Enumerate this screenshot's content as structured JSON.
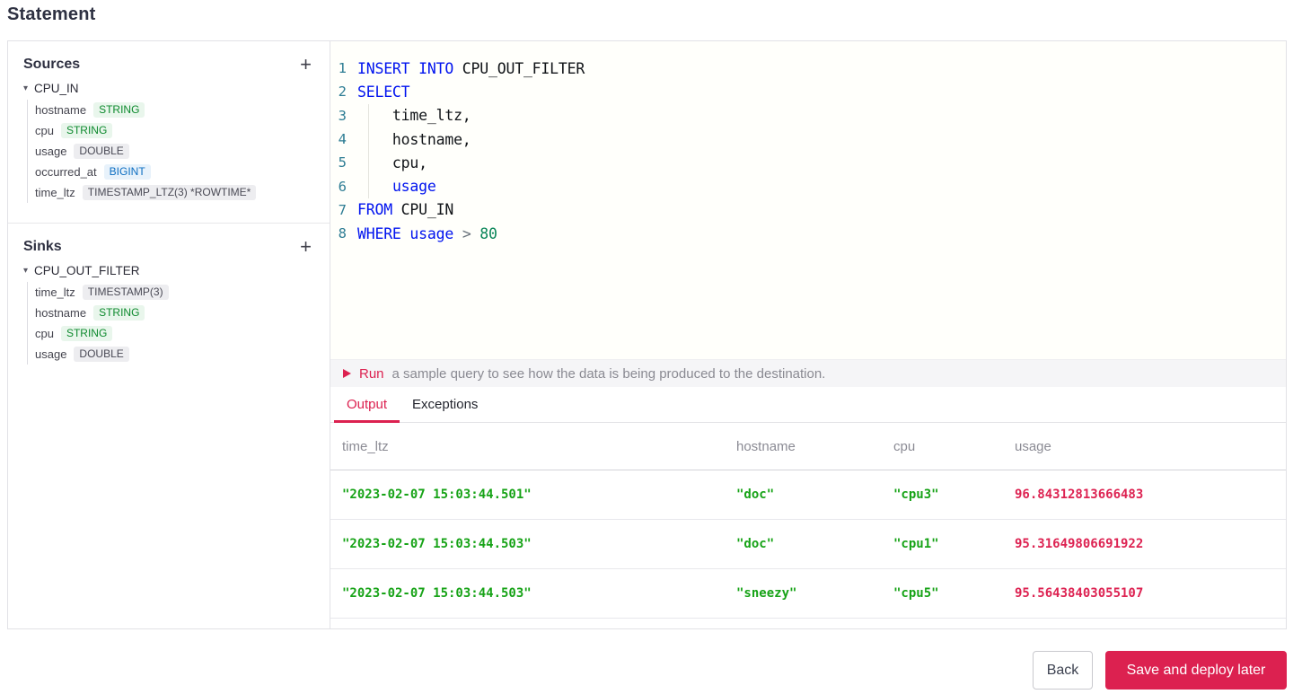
{
  "page": {
    "title": "Statement"
  },
  "colors": {
    "accent_crimson": "#DC2150",
    "keyword_blue": "#0013EF",
    "number_green": "#098658",
    "line_number_teal": "#2E7D94",
    "table_value_green": "#17A317",
    "table_value_red": "#DD2352",
    "badge_green_text": "#0E8A2E",
    "badge_blue_text": "#0D6EC1",
    "badge_gray_text": "#4A4A55"
  },
  "icons": {
    "caret_down": "▾",
    "plus": "+",
    "play": "triangle-right"
  },
  "sources_panel": {
    "title": "Sources",
    "table": {
      "name": "CPU_IN",
      "fields": [
        {
          "name": "hostname",
          "type": "STRING",
          "style": "green"
        },
        {
          "name": "cpu",
          "type": "STRING",
          "style": "green"
        },
        {
          "name": "usage",
          "type": "DOUBLE",
          "style": "gray"
        },
        {
          "name": "occurred_at",
          "type": "BIGINT",
          "style": "blue"
        },
        {
          "name": "time_ltz",
          "type": "TIMESTAMP_LTZ(3) *ROWTIME*",
          "style": "gray"
        }
      ]
    }
  },
  "sinks_panel": {
    "title": "Sinks",
    "table": {
      "name": "CPU_OUT_FILTER",
      "fields": [
        {
          "name": "time_ltz",
          "type": "TIMESTAMP(3)",
          "style": "gray"
        },
        {
          "name": "hostname",
          "type": "STRING",
          "style": "green"
        },
        {
          "name": "cpu",
          "type": "STRING",
          "style": "green"
        },
        {
          "name": "usage",
          "type": "DOUBLE",
          "style": "gray"
        }
      ]
    }
  },
  "editor": {
    "lines": [
      {
        "num": "1",
        "tokens": [
          {
            "text": "INSERT INTO",
            "type": "keyword"
          },
          {
            "text": " CPU_OUT_FILTER",
            "type": "identifier"
          }
        ]
      },
      {
        "num": "2",
        "tokens": [
          {
            "text": "SELECT",
            "type": "keyword"
          }
        ]
      },
      {
        "num": "3",
        "tokens": [
          {
            "text": "    time_ltz,",
            "type": "identifier"
          }
        ]
      },
      {
        "num": "4",
        "tokens": [
          {
            "text": "    hostname,",
            "type": "identifier"
          }
        ]
      },
      {
        "num": "5",
        "tokens": [
          {
            "text": "    cpu,",
            "type": "identifier"
          }
        ]
      },
      {
        "num": "6",
        "tokens": [
          {
            "text": "    ",
            "type": "identifier"
          },
          {
            "text": "usage",
            "type": "keyword"
          }
        ]
      },
      {
        "num": "7",
        "tokens": [
          {
            "text": "FROM",
            "type": "keyword"
          },
          {
            "text": " CPU_IN",
            "type": "identifier"
          }
        ]
      },
      {
        "num": "8",
        "tokens": [
          {
            "text": "WHERE",
            "type": "keyword"
          },
          {
            "text": " ",
            "type": "identifier"
          },
          {
            "text": "usage",
            "type": "keyword"
          },
          {
            "text": " ",
            "type": "identifier"
          },
          {
            "text": ">",
            "type": "operator"
          },
          {
            "text": " ",
            "type": "identifier"
          },
          {
            "text": "80",
            "type": "number"
          }
        ]
      }
    ]
  },
  "run_bar": {
    "run_label": "Run",
    "message": "a sample query to see how the data is being produced to the destination."
  },
  "tabs": [
    {
      "label": "Output",
      "active": true
    },
    {
      "label": "Exceptions",
      "active": false
    }
  ],
  "output_table": {
    "columns": [
      {
        "label": "time_ltz",
        "cell_style": "green"
      },
      {
        "label": "hostname",
        "cell_style": "green"
      },
      {
        "label": "cpu",
        "cell_style": "green"
      },
      {
        "label": "usage",
        "cell_style": "red"
      }
    ],
    "rows": [
      [
        "\"2023-02-07 15:03:44.501\"",
        "\"doc\"",
        "\"cpu3\"",
        "96.84312813666483"
      ],
      [
        "\"2023-02-07 15:03:44.503\"",
        "\"doc\"",
        "\"cpu1\"",
        "95.31649806691922"
      ],
      [
        "\"2023-02-07 15:03:44.503\"",
        "\"sneezy\"",
        "\"cpu5\"",
        "95.56438403055107"
      ]
    ]
  },
  "footer": {
    "back_label": "Back",
    "save_label": "Save and deploy later"
  }
}
